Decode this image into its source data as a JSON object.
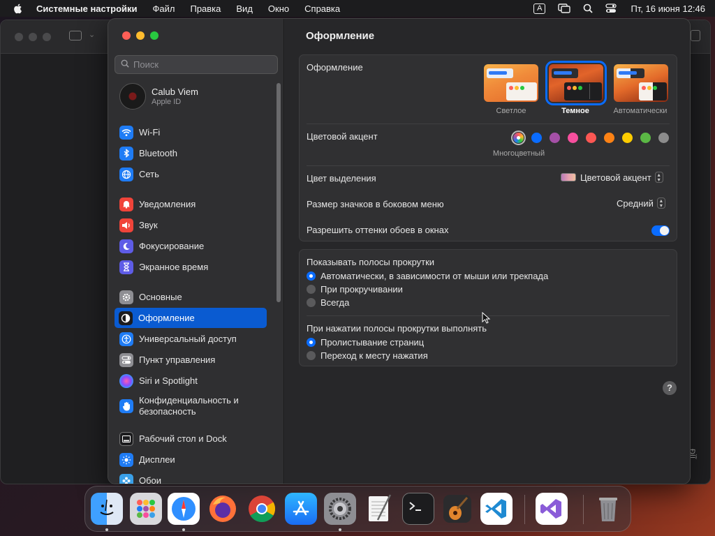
{
  "menubar": {
    "app_name": "Системные настройки",
    "items": [
      "Файл",
      "Правка",
      "Вид",
      "Окно",
      "Справка"
    ],
    "input_indicator": "A",
    "clock": "Пт, 16 июня  12:46"
  },
  "background_window": {
    "side_text": "ĐÌĨ"
  },
  "sidebar": {
    "search_placeholder": "Поиск",
    "account": {
      "name": "Calub Viem",
      "subtitle": "Apple ID"
    },
    "items": [
      {
        "label": "Wi-Fi",
        "icon": "wifi-icon",
        "color": "#1f7cf5"
      },
      {
        "label": "Bluetooth",
        "icon": "bluetooth-icon",
        "color": "#1f7cf5"
      },
      {
        "label": "Сеть",
        "icon": "globe-icon",
        "color": "#1f7cf5"
      },
      {
        "label": "Уведомления",
        "icon": "bell-icon",
        "color": "#f0443a"
      },
      {
        "label": "Звук",
        "icon": "speaker-icon",
        "color": "#f0443a"
      },
      {
        "label": "Фокусирование",
        "icon": "moon-icon",
        "color": "#5e5ce6"
      },
      {
        "label": "Экранное время",
        "icon": "hourglass-icon",
        "color": "#5e5ce6"
      },
      {
        "label": "Основные",
        "icon": "gear-icon",
        "color": "#8e8e93"
      },
      {
        "label": "Оформление",
        "icon": "appearance-icon",
        "color": "#1c1c1e"
      },
      {
        "label": "Универсальный доступ",
        "icon": "accessibility-icon",
        "color": "#1f7cf5"
      },
      {
        "label": "Пункт управления",
        "icon": "control-center-icon",
        "color": "#8e8e93"
      },
      {
        "label": "Siri и Spotlight",
        "icon": "siri-icon",
        "color": "#b04fd8"
      },
      {
        "label_line1": "Конфиденциальность и",
        "label_line2": "безопасность",
        "icon": "hand-icon",
        "color": "#1f7cf5"
      },
      {
        "label": "Рабочий стол и Dock",
        "icon": "dock-icon",
        "color": "#1c1c1e"
      },
      {
        "label": "Дисплеи",
        "icon": "sun-icon",
        "color": "#1f7cf5"
      },
      {
        "label": "Обои",
        "icon": "wallpaper-icon",
        "color": "#3aa0e8"
      }
    ],
    "selected_item": "Оформление"
  },
  "main": {
    "title": "Оформление",
    "appearance": {
      "label": "Оформление",
      "options": [
        {
          "label": "Светлое",
          "selected": false
        },
        {
          "label": "Темное",
          "selected": true
        },
        {
          "label": "Автоматически",
          "selected": false
        }
      ]
    },
    "accent": {
      "label": "Цветовой акцент",
      "colors": [
        "multicolor",
        "#0a6cff",
        "#a550a7",
        "#f74f9e",
        "#fc5753",
        "#fd8215",
        "#fdcc00",
        "#5bb845",
        "#8c8c8c"
      ],
      "selected_caption": "Многоцветный"
    },
    "highlight": {
      "label": "Цвет выделения",
      "value": "Цветовой акцент"
    },
    "sidebar_icon_size": {
      "label": "Размер значков в боковом меню",
      "value": "Средний"
    },
    "wallpaper_tint": {
      "label": "Разрешить оттенки обоев в окнах",
      "enabled": true
    },
    "scrollbars": {
      "label": "Показывать полосы прокрутки",
      "options": [
        {
          "label": "Автоматически, в зависимости от мыши или трекпада",
          "selected": true
        },
        {
          "label": "При прокручивании",
          "selected": false
        },
        {
          "label": "Всегда",
          "selected": false
        }
      ]
    },
    "scroll_click": {
      "label": "При нажатии полосы прокрутки выполнять",
      "options": [
        {
          "label": "Пролистывание страниц",
          "selected": true
        },
        {
          "label": "Переход к месту нажатия",
          "selected": false
        }
      ]
    },
    "help_label": "?"
  },
  "dock": {
    "apps": [
      {
        "name": "Finder",
        "icon": "finder-icon",
        "running": true
      },
      {
        "name": "Launchpad",
        "icon": "launchpad-icon",
        "running": false
      },
      {
        "name": "Safari",
        "icon": "safari-icon",
        "running": true
      },
      {
        "name": "Firefox",
        "icon": "firefox-icon",
        "running": false
      },
      {
        "name": "Chrome",
        "icon": "chrome-icon",
        "running": false
      },
      {
        "name": "App Store",
        "icon": "appstore-icon",
        "running": false
      },
      {
        "name": "System Settings",
        "icon": "settings-icon",
        "running": true
      },
      {
        "name": "TextEdit",
        "icon": "textedit-icon",
        "running": false
      },
      {
        "name": "Terminal",
        "icon": "terminal-icon",
        "running": false
      },
      {
        "name": "GarageBand",
        "icon": "garageband-icon",
        "running": false
      },
      {
        "name": "VS Code",
        "icon": "vscode-icon",
        "running": false
      },
      {
        "name": "Visual Studio",
        "icon": "visualstudio-icon",
        "running": false
      },
      {
        "name": "Trash",
        "icon": "trash-icon",
        "running": false
      }
    ]
  }
}
